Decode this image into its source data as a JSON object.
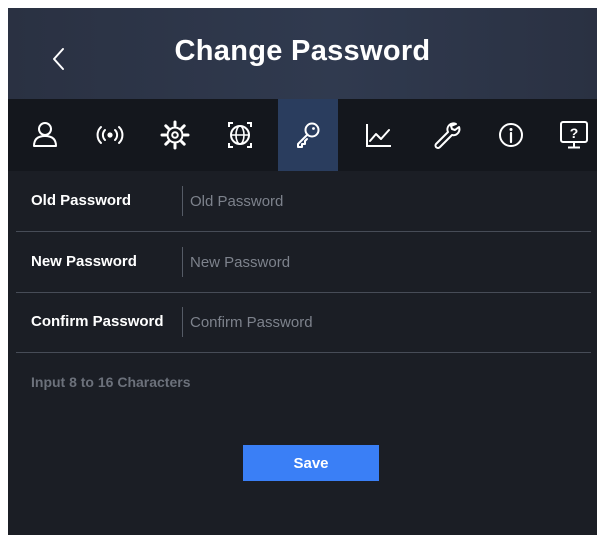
{
  "header": {
    "title": "Change Password",
    "back_icon": "chevron-left-icon"
  },
  "tabs": [
    {
      "icon": "user-icon",
      "active": false
    },
    {
      "icon": "wireless-signal-icon",
      "active": false
    },
    {
      "icon": "gear-icon",
      "active": false
    },
    {
      "icon": "globe-network-icon",
      "active": false
    },
    {
      "icon": "key-icon",
      "active": true
    },
    {
      "icon": "line-chart-icon",
      "active": false
    },
    {
      "icon": "wrench-icon",
      "active": false
    },
    {
      "icon": "info-icon",
      "active": false
    },
    {
      "icon": "help-monitor-icon",
      "active": false
    }
  ],
  "form": {
    "old_password": {
      "label": "Old Password",
      "placeholder": "Old Password",
      "value": ""
    },
    "new_password": {
      "label": "New Password",
      "placeholder": "New Password",
      "value": ""
    },
    "confirm_password": {
      "label": "Confirm Password",
      "placeholder": "Confirm Password",
      "value": ""
    },
    "hint": "Input 8 to 16 Characters"
  },
  "actions": {
    "save_label": "Save"
  },
  "colors": {
    "background": "#1b1e25",
    "header": "#303a4f",
    "tabbar": "#14171d",
    "active_tab": "#2a3d5e",
    "accent": "#3a7ff6",
    "divider": "#474c57"
  }
}
